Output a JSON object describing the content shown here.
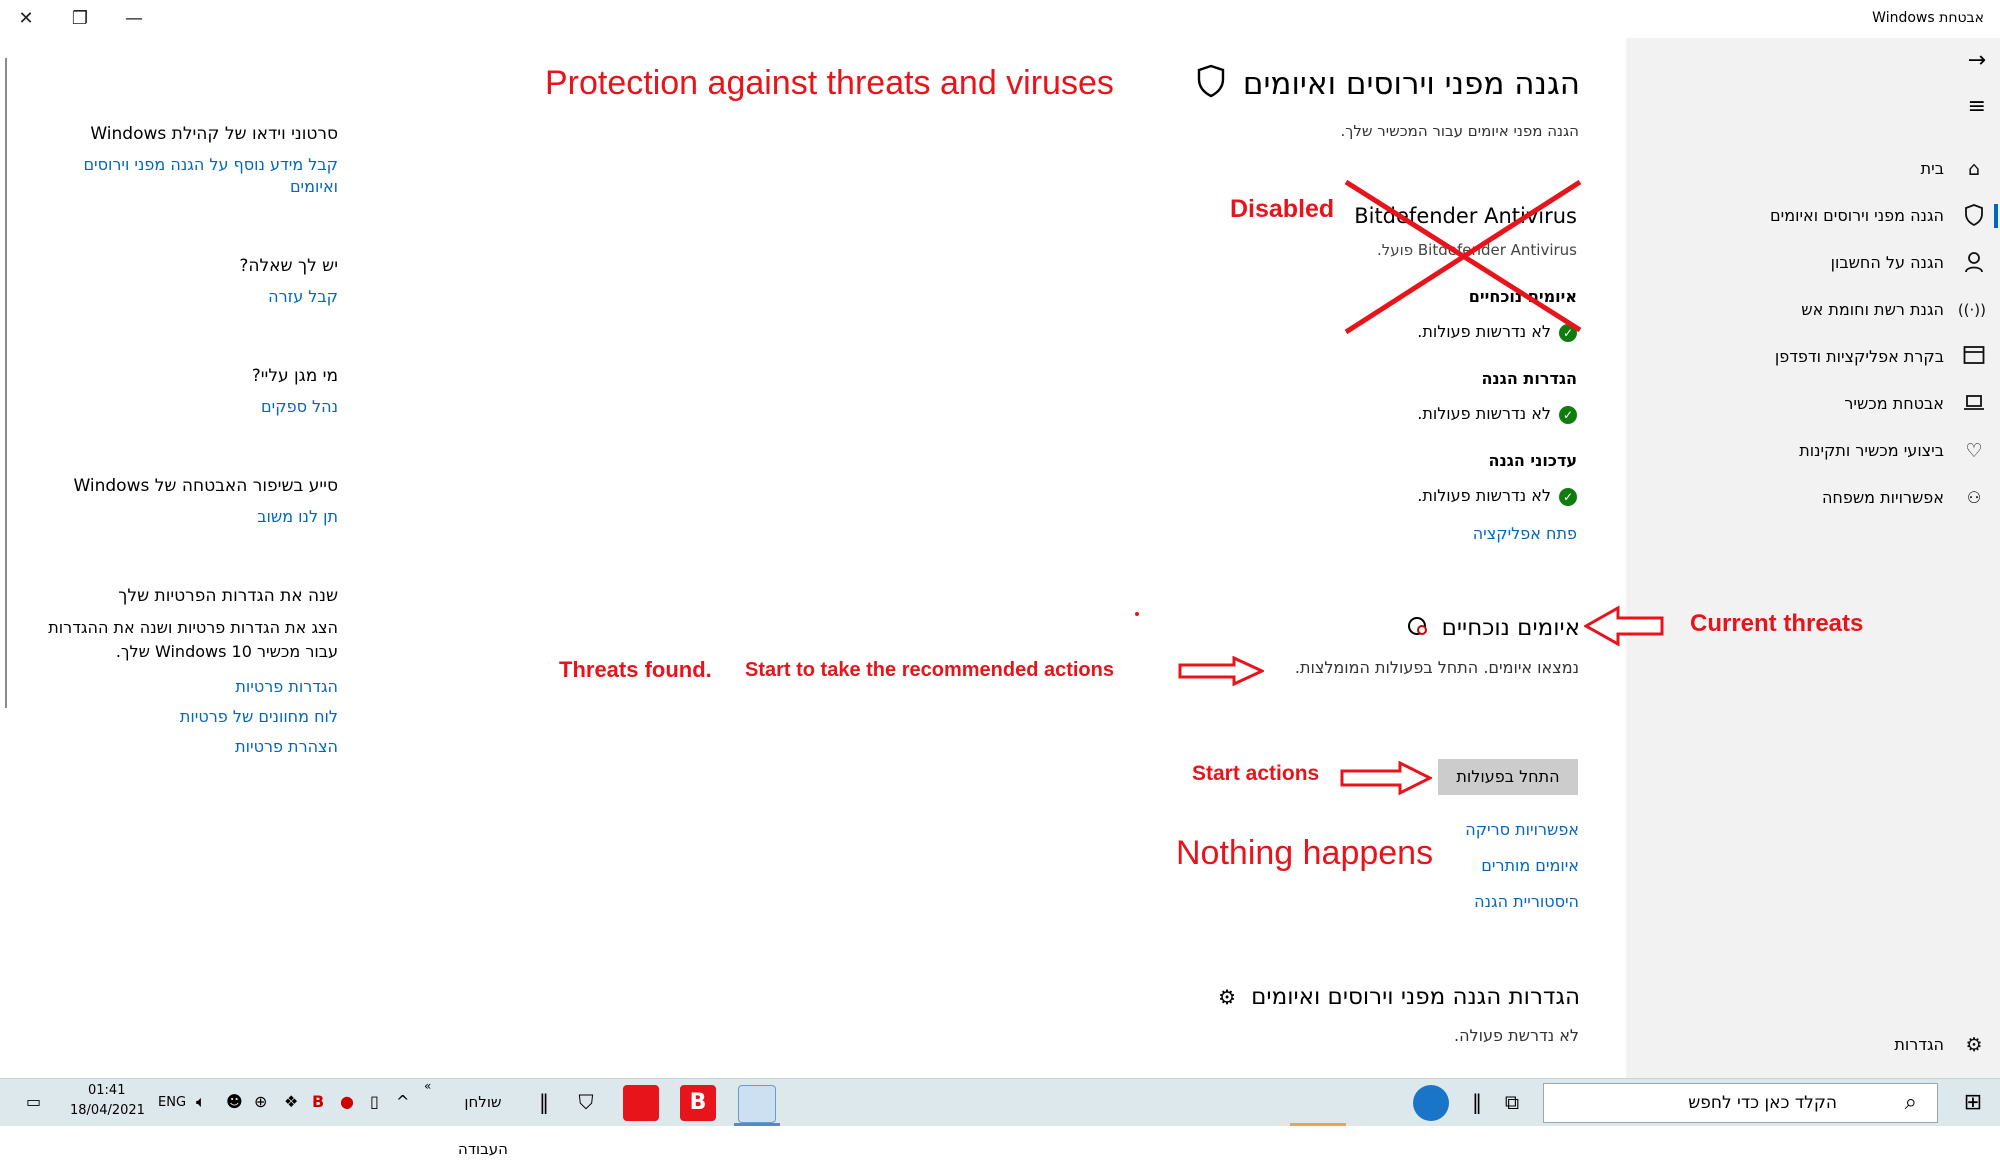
{
  "window": {
    "title": "אבטחת Windows"
  },
  "sidebar": {
    "items": [
      {
        "label": "בית",
        "icon": "home-icon"
      },
      {
        "label": "הגנה מפני וירוסים ואיומים",
        "icon": "shield-icon",
        "active": true
      },
      {
        "label": "הגנה על החשבון",
        "icon": "person-icon"
      },
      {
        "label": "הגנת רשת וחומת אש",
        "icon": "wifi-icon"
      },
      {
        "label": "בקרת אפליקציות ודפדפן",
        "icon": "browser-icon"
      },
      {
        "label": "אבטחת מכשיר",
        "icon": "laptop-icon"
      },
      {
        "label": "ביצועי מכשיר ותקינות",
        "icon": "heart-icon"
      },
      {
        "label": "אפשרויות משפחה",
        "icon": "family-icon"
      }
    ],
    "settings_label": "הגדרות"
  },
  "main": {
    "title": "הגנה מפני וירוסים ואיומים",
    "subtitle": "הגנה מפני איומים עבור המכשיר שלך.",
    "av_name": "Bitdefender Antivirus",
    "av_status": "Bitdefender Antivirus פועל.",
    "sections": [
      {
        "heading": "איומים נוכחיים",
        "status": "לא נדרשות פעולות."
      },
      {
        "heading": "הגדרות הגנה",
        "status": "לא נדרשות פעולות."
      },
      {
        "heading": "עדכוני הגנה",
        "status": "לא נדרשות פעולות."
      }
    ],
    "open_app_link": "פתח אפליקציה",
    "threats_title": "איומים נוכחיים",
    "threats_text": "נמצאו איומים. התחל בפעולות המומלצות.",
    "start_button": "התחל בפעולות",
    "links": [
      "אפשרויות סריקה",
      "איומים מותרים",
      "היסטוריית הגנה"
    ],
    "settings_title": "הגדרות הגנה מפני וירוסים ואיומים",
    "settings_text": "לא נדרשת פעולה."
  },
  "help": {
    "community_title": "סרטוני וידאו של קהילת Windows",
    "community_link": "קבל מידע נוסף על הגנה מפני וירוסים ואיומים",
    "question_title": "יש לך שאלה?",
    "question_link": "קבל עזרה",
    "protect_title": "מי מגן עליי?",
    "protect_link": "נהל ספקים",
    "improve_title": "סייע בשיפור האבטחה של Windows",
    "improve_link": "תן לנו משוב",
    "privacy_title": "שנה את הגדרות הפרטיות שלך",
    "privacy_text": "הצג את הגדרות פרטיות ושנה את ההגדרות עבור מכשיר Windows 10 שלך.",
    "privacy_links": [
      "הגדרות פרטיות",
      "לוח מחוונים של פרטיות",
      "הצהרת פרטיות"
    ]
  },
  "annotations": {
    "protection": "Protection against threats and viruses",
    "disabled": "Disabled",
    "current_threats": "Current threats",
    "threats_found": "Threats found.",
    "start_recommended": "Start to take the recommended actions",
    "start_actions": "Start actions",
    "nothing_happens": "Nothing happens",
    "color": "#e8141b"
  },
  "taskbar": {
    "search_placeholder": "הקלד כאן כדי לחפש",
    "desktop_label": "שולחן העבודה",
    "lang": "ENG",
    "time": "01:41",
    "date": "18/04/2021"
  }
}
